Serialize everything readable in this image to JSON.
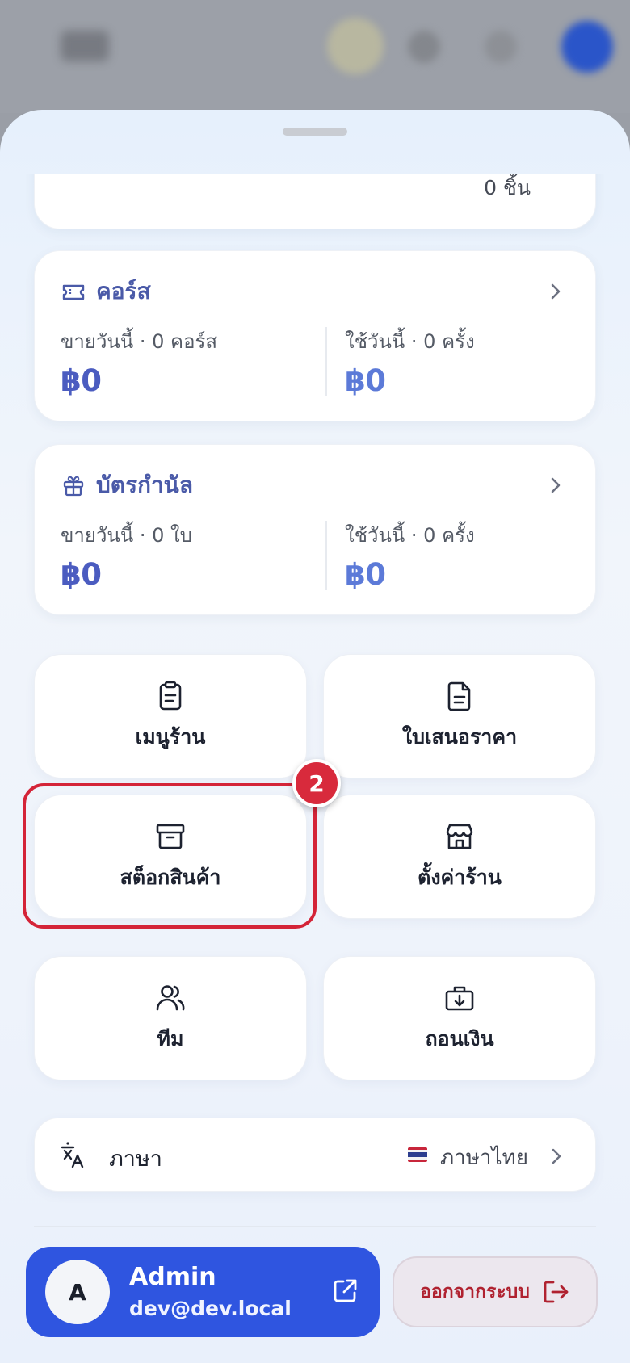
{
  "partial_card": {
    "value": "0 ชิ้น"
  },
  "course": {
    "title": "คอร์ส",
    "sold_label": "ขายวันนี้ · 0 คอร์ส",
    "sold_value": "฿0",
    "used_label": "ใช้วันนี้ · 0 ครั้ง",
    "used_value": "฿0"
  },
  "voucher": {
    "title": "บัตรกำนัล",
    "sold_label": "ขายวันนี้ · 0 ใบ",
    "sold_value": "฿0",
    "used_label": "ใช้วันนี้ · 0 ครั้ง",
    "used_value": "฿0"
  },
  "tiles": {
    "menu": "เมนูร้าน",
    "quotation": "ใบเสนอราคา",
    "stock": "สต็อกสินค้า",
    "settings": "ตั้งค่าร้าน",
    "team": "ทีม",
    "withdraw": "ถอนเงิน"
  },
  "badge": "2",
  "language": {
    "label": "ภาษา",
    "value": "ภาษาไทย"
  },
  "profile": {
    "initial": "A",
    "name": "Admin",
    "email": "dev@dev.local"
  },
  "logout_label": "ออกจากระบบ",
  "colors": {
    "accent": "#2f55e0",
    "title": "#4a5aa8",
    "highlight": "#d42438",
    "logout": "#b02230"
  }
}
